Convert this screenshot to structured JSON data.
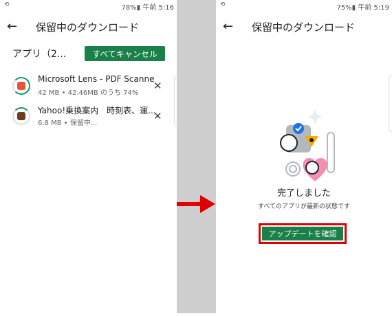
{
  "left": {
    "status": {
      "sync_icon": "sync-icon",
      "right": "78%▮ 午前 5:16"
    },
    "title": "保留中のダウンロード",
    "section": "アプリ（2...",
    "cancel_all": "すべてキャンセル",
    "items": [
      {
        "name": "Microsoft Lens - PDF Scanner",
        "meta": "42 MB • 42.46MB のうち 74%",
        "progress": 0.74,
        "accent": "#0f9d58",
        "icon": "lens-app-icon"
      },
      {
        "name": "Yahoo!乗換案内　時刻表、運...",
        "meta": "6.8 MB • 保留中...",
        "progress": 0.1,
        "accent": "#0f9d58",
        "icon": "yahoo-transit-app-icon"
      }
    ]
  },
  "right": {
    "status": {
      "sync_icon": "sync-icon",
      "right": "75%▮ 午前 5:19"
    },
    "title": "保留中のダウンロード",
    "complete": "完了しました",
    "sub": "すべてのアプリが最新の状態です",
    "check_updates": "アップデートを確認"
  },
  "colors": {
    "accent": "#1a7f49",
    "highlight": "#e00000",
    "arrow": "#e00000"
  }
}
